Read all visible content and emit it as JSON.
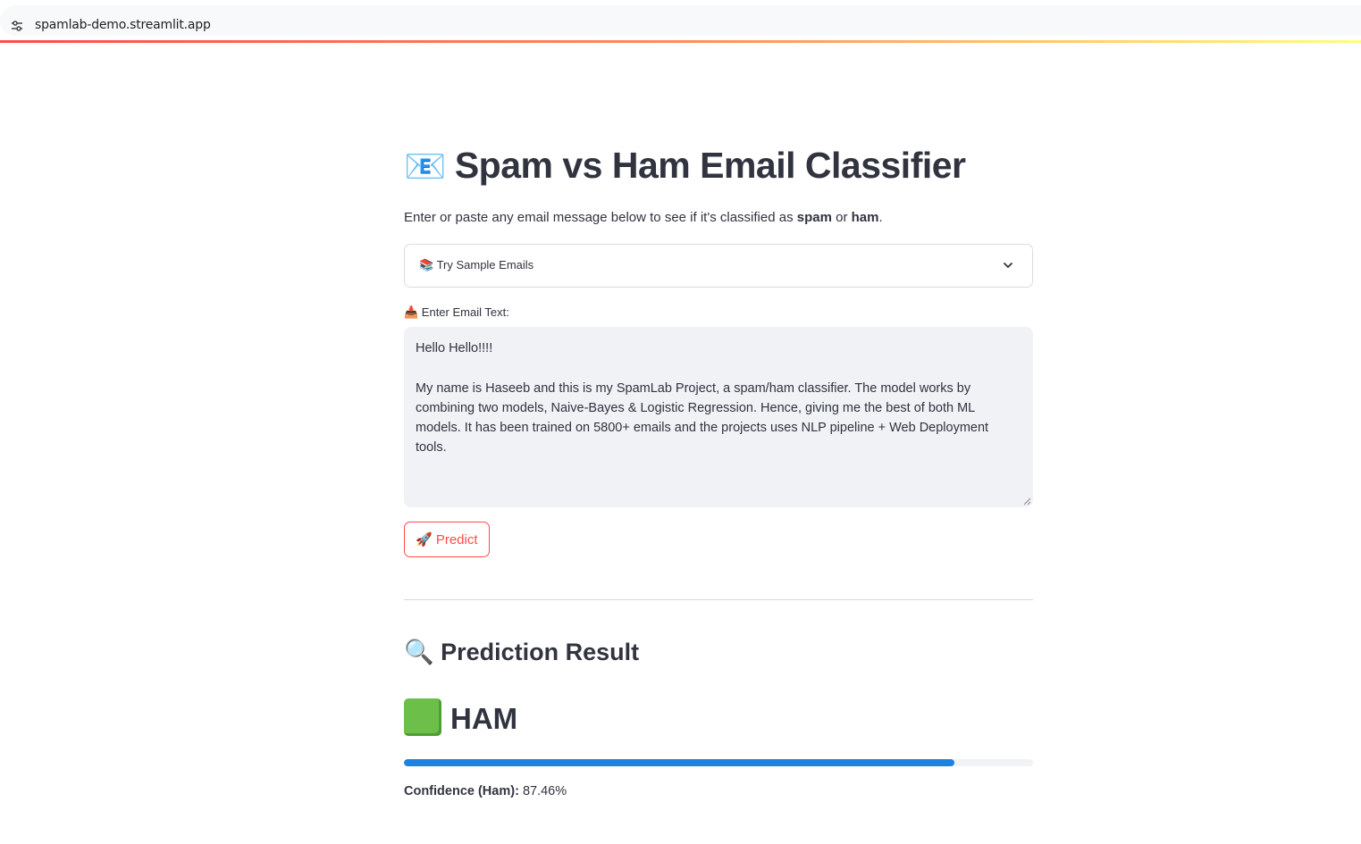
{
  "browser": {
    "url": "spamlab-demo.streamlit.app",
    "site_icon": "tune-icon"
  },
  "app": {
    "title_emoji": "📧",
    "title": "Spam vs Ham Email Classifier",
    "description": {
      "prefix": "Enter or paste any email message below to see if it's classified as ",
      "spam": "spam",
      "or": " or ",
      "ham": "ham",
      "suffix": "."
    },
    "samples_expander": {
      "label": "📚 Try Sample Emails",
      "icon": "chevron-down-icon"
    },
    "email_input": {
      "label": "📥 Enter Email Text:",
      "value": "Hello Hello!!!!\n\nMy name is Haseeb and this is my SpamLab Project, a spam/ham classifier. The model works by combining two models, Naive-Bayes & Logistic Regression. Hence, giving me the best of both ML models. It has been trained on 5800+ emails and the projects uses NLP pipeline + Web Deployment tools."
    },
    "predict_button": "🚀 Predict",
    "result": {
      "heading": "🔍 Prediction Result",
      "label": "HAM",
      "confidence_label": "Confidence (Ham):",
      "confidence_value": "87.46%",
      "confidence_fraction": 0.8746,
      "progress_color": "#1c83e1",
      "accent_color": "#ff4b4b"
    }
  }
}
